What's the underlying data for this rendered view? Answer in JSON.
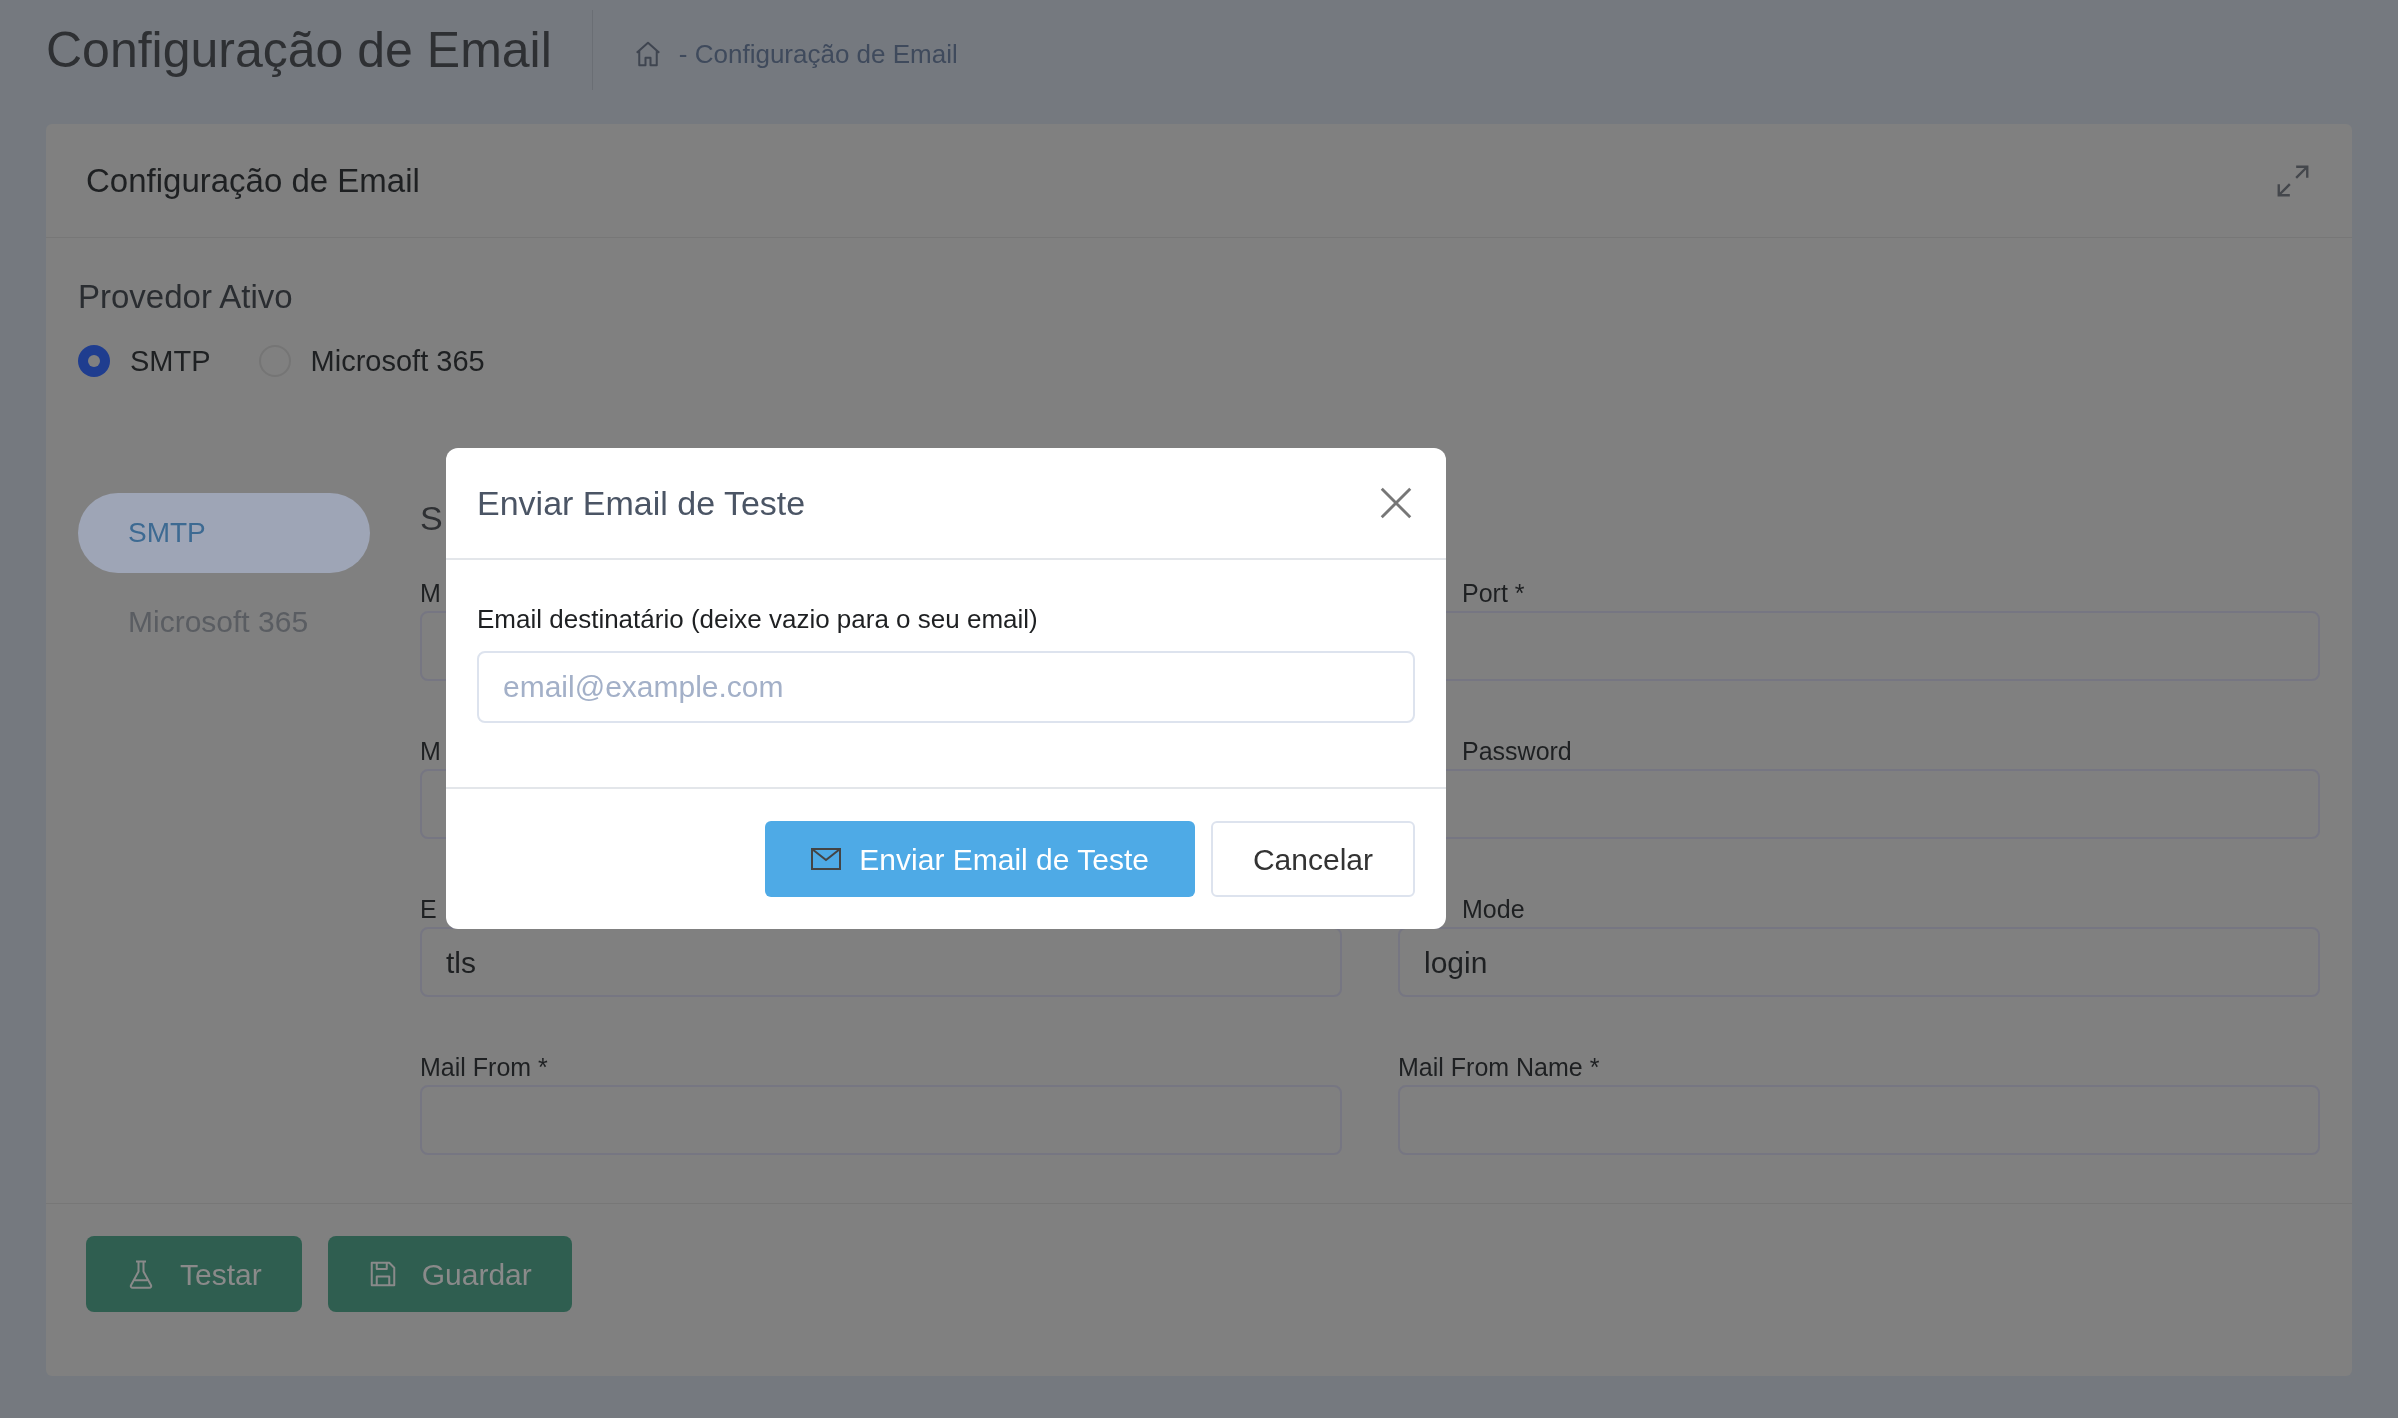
{
  "page": {
    "title": "Configuração de Email",
    "breadcrumb": "- Configuração de Email"
  },
  "card": {
    "title": "Configuração de Email",
    "provider": {
      "label": "Provedor Ativo",
      "options": [
        {
          "label": "SMTP",
          "selected": true
        },
        {
          "label": "Microsoft 365",
          "selected": false
        }
      ]
    },
    "tabs": [
      {
        "label": "SMTP",
        "selected": true
      },
      {
        "label": "Microsoft 365",
        "selected": false
      }
    ],
    "section_title": "S",
    "fields": [
      {
        "label": "M"
      },
      {
        "label": "Port *",
        "cut_start": true
      },
      {
        "label": "M"
      },
      {
        "label": "Password",
        "cut_start": true
      },
      {
        "label": "E",
        "value": "tls"
      },
      {
        "label": "Mode",
        "value": "login",
        "cut_start": true
      },
      {
        "label": "Mail From *"
      },
      {
        "label": "Mail From Name *"
      }
    ],
    "actions": [
      {
        "label": "Testar",
        "kind": "test"
      },
      {
        "label": "Guardar",
        "kind": "save"
      }
    ]
  },
  "modal": {
    "title": "Enviar Email de Teste",
    "field_label": "Email destinatário (deixe vazio para o seu email)",
    "placeholder": "email@example.com",
    "buttons": [
      {
        "label": "Enviar Email de Teste",
        "kind": "primary"
      },
      {
        "label": "Cancelar",
        "kind": "secondary"
      }
    ]
  }
}
